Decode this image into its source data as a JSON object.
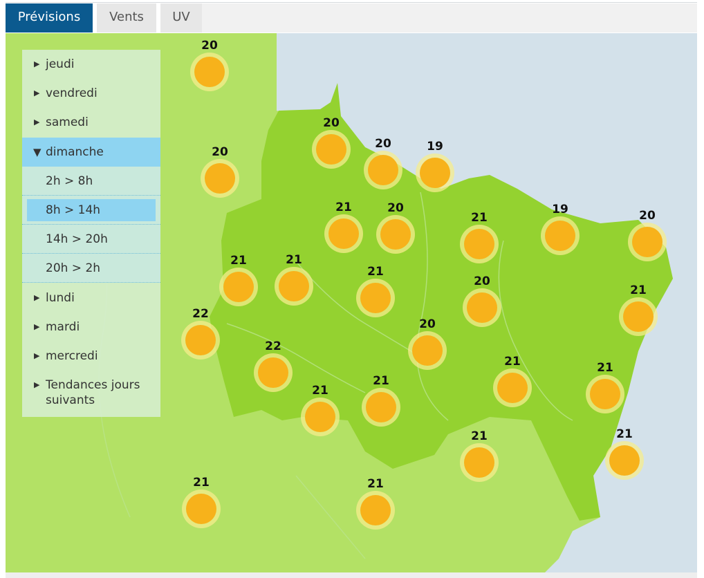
{
  "tabs": [
    {
      "label": "Prévisions",
      "active": true
    },
    {
      "label": "Vents",
      "active": false
    },
    {
      "label": "UV",
      "active": false
    }
  ],
  "menu": {
    "days_before": [
      "jeudi",
      "vendredi",
      "samedi"
    ],
    "open_day": "dimanche",
    "slots": [
      "2h > 8h",
      "8h > 14h",
      "14h > 20h",
      "20h > 2h"
    ],
    "selected_slot": "8h > 14h",
    "days_after": [
      "lundi",
      "mardi",
      "mercredi"
    ],
    "trends": "Tendances jours suivants"
  },
  "map": {
    "weather_icon": "sun-icon",
    "colors": {
      "sea": "#d3e1ea",
      "land": "#b3e165",
      "region": "#94d230",
      "sun": "#f7b21b",
      "selected": "#8ed4f1",
      "active_tab": "#0b5a8f"
    },
    "temperatures": [
      "20",
      "20",
      "20",
      "20",
      "19",
      "21",
      "20",
      "21",
      "19",
      "20",
      "21",
      "21",
      "21",
      "20",
      "21",
      "22",
      "20",
      "22",
      "21",
      "21",
      "21",
      "21",
      "21",
      "21",
      "21",
      "21"
    ]
  }
}
